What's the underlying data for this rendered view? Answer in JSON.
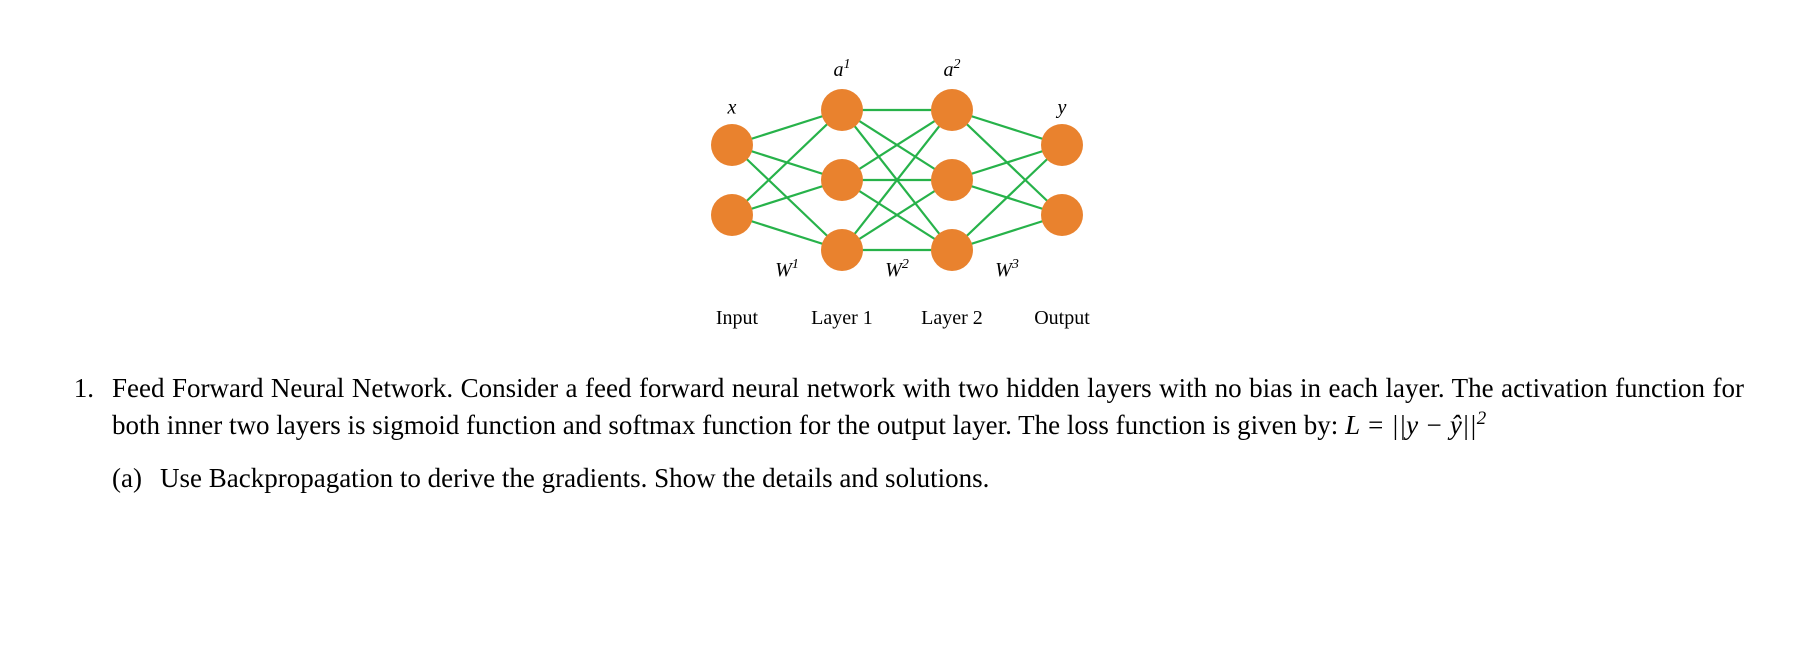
{
  "diagram": {
    "labels": {
      "x": "x",
      "a1_base": "a",
      "a1_sup": "1",
      "a2_base": "a",
      "a2_sup": "2",
      "y": "y",
      "w1_base": "W",
      "w1_sup": "1",
      "w2_base": "W",
      "w2_sup": "2",
      "w3_base": "W",
      "w3_sup": "3"
    },
    "captions": {
      "input": "Input",
      "layer1": "Layer 1",
      "layer2": "Layer 2",
      "output": "Output"
    }
  },
  "problem": {
    "number": "1.",
    "title_prefix": "Feed Forward Neural Network.",
    "text_rest": " Consider a feed forward neural network with two hidden layers with no bias in each layer. The activation function for both inner two layers is sigmoid function and softmax function for the output layer. The loss function is given by: ",
    "loss_prefix": "L = ||",
    "loss_y": "y",
    "loss_minus": " − ",
    "loss_yhat": "ŷ",
    "loss_suffix": "||",
    "loss_exp": "2",
    "sub_a_label": "(a)",
    "sub_a_text": "Use Backpropagation to derive the gradients. Show the details and solutions."
  }
}
